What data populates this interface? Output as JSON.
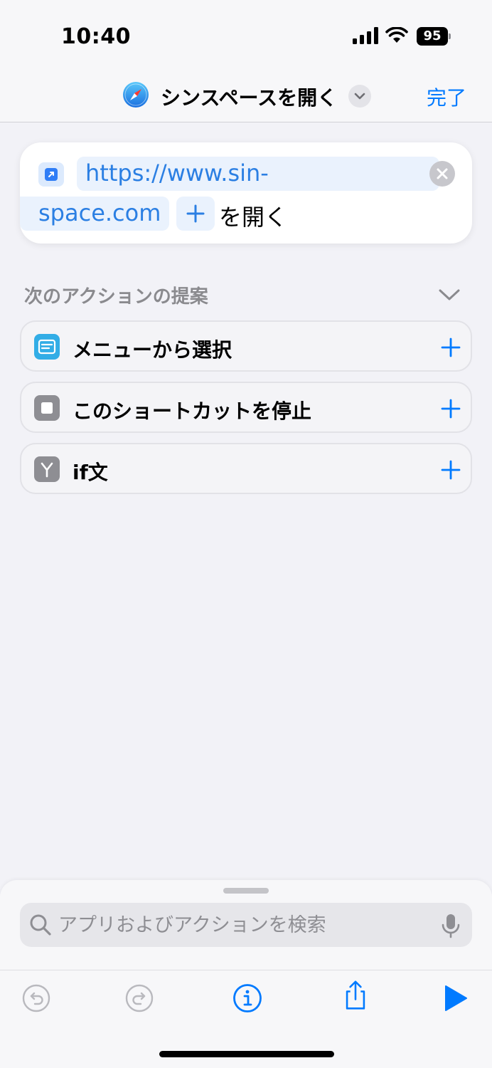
{
  "status_bar": {
    "time": "10:40",
    "battery": "95"
  },
  "nav": {
    "title": "シンスペースを開く",
    "done_label": "完了",
    "app_icon": "safari-compass-icon",
    "accent_color": "#007aff"
  },
  "action": {
    "url_line1": "https://www.sin-",
    "url_line2": "space.com",
    "plus_label": "+",
    "open_label": "を開く"
  },
  "suggestions": {
    "header": "次のアクションの提案",
    "items": [
      {
        "label": "メニューから選択",
        "icon": "menu-list-icon",
        "color": "#32ade6"
      },
      {
        "label": "このショートカットを停止",
        "icon": "stop-square-icon",
        "color": "#8e8e93"
      },
      {
        "label": "if文",
        "icon": "branch-icon",
        "color": "#8e8e93"
      }
    ]
  },
  "bottom": {
    "search_placeholder": "アプリおよびアクションを検索"
  }
}
